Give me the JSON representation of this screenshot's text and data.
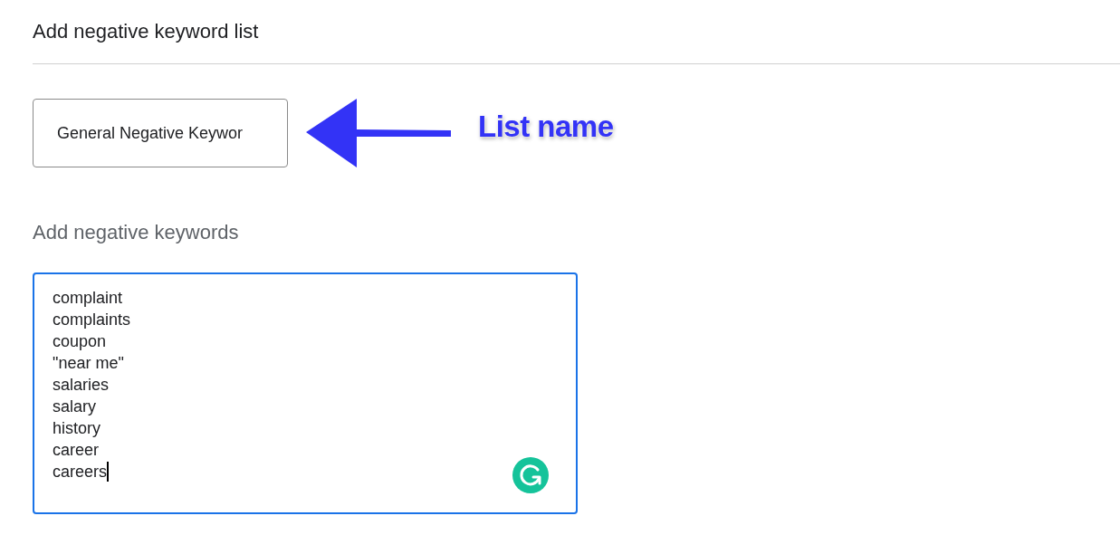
{
  "title": "Add negative keyword list",
  "list_name": {
    "value": "General Negative Keywor"
  },
  "annotation": {
    "label": "List name"
  },
  "keywords_section": {
    "label": "Add negative keywords",
    "focused": true,
    "keywords": [
      "complaint",
      "complaints",
      "coupon",
      "\"near me\"",
      "salaries",
      "salary",
      "history",
      "career",
      "careers"
    ]
  }
}
